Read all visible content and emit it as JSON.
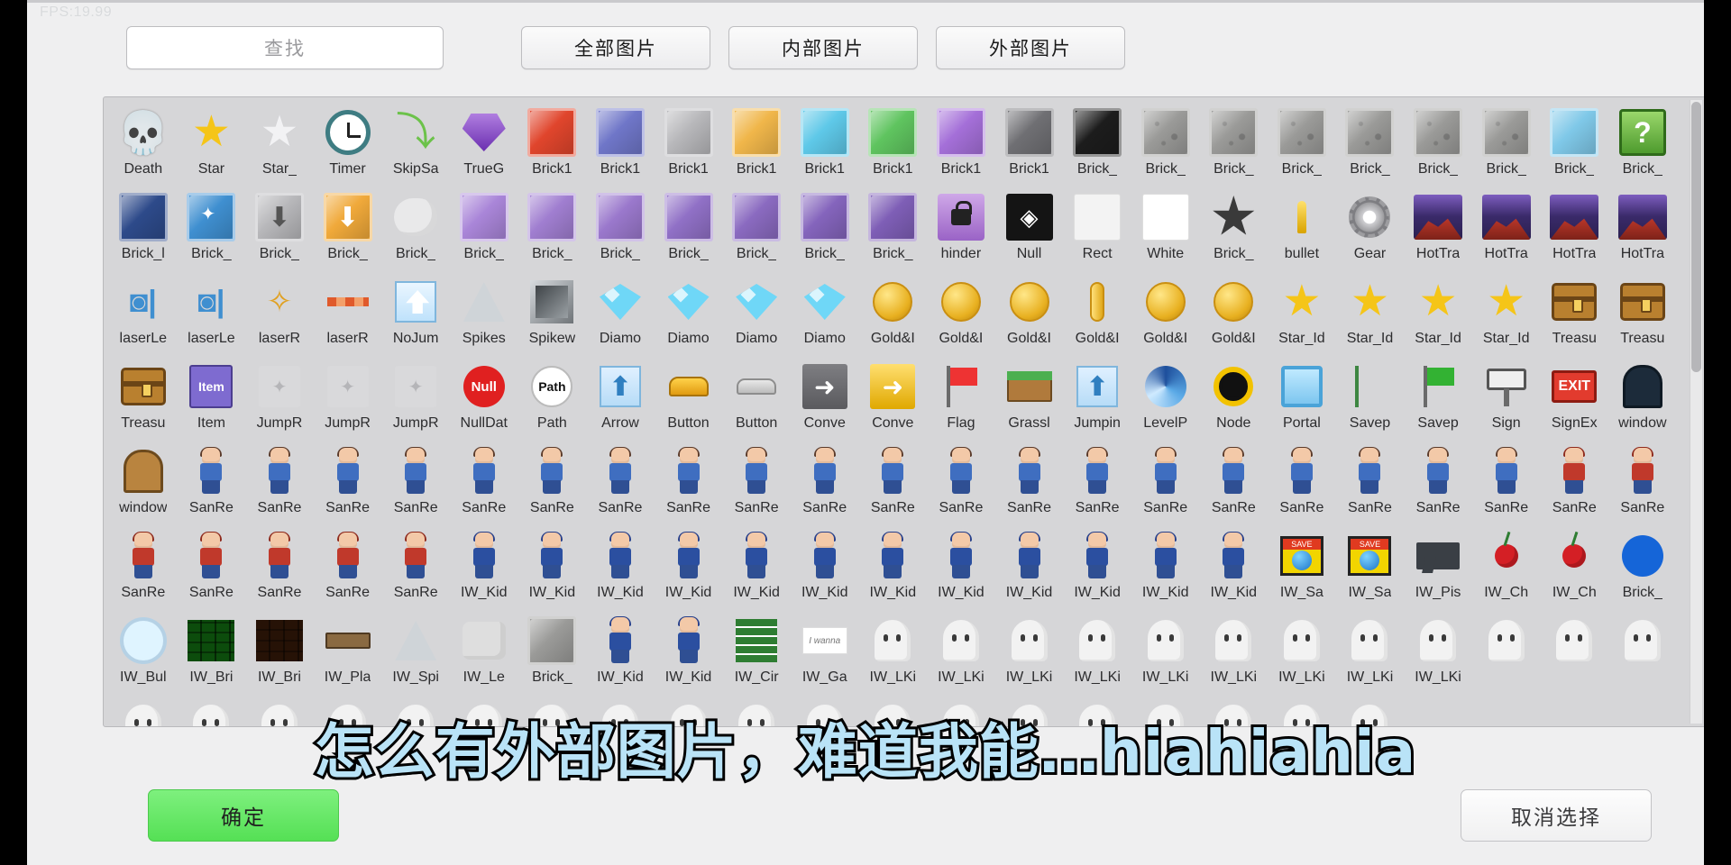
{
  "overlay": {
    "fps": "FPS:19.99",
    "subtitle": "怎么有外部图片，难道我能…hiahiahia"
  },
  "toolbar": {
    "search_placeholder": "查找",
    "search_value": "",
    "tabs": [
      {
        "label": "全部图片",
        "name": "tab-all-images"
      },
      {
        "label": "内部图片",
        "name": "tab-internal-images"
      },
      {
        "label": "外部图片",
        "name": "tab-external-images"
      }
    ]
  },
  "footer": {
    "confirm_label": "确定",
    "cancel_label": "取消选择"
  },
  "grid": {
    "items": [
      {
        "cap": "Death",
        "icon": "skull-icon"
      },
      {
        "cap": "Star",
        "icon": "star-yellow-icon"
      },
      {
        "cap": "Star_",
        "icon": "star-white-icon"
      },
      {
        "cap": "Timer",
        "icon": "clock-icon"
      },
      {
        "cap": "SkipSa",
        "icon": "green-arrow-icon"
      },
      {
        "cap": "TrueG",
        "icon": "purple-gem-icon"
      },
      {
        "cap": "Brick1",
        "icon": "brick-red-icon"
      },
      {
        "cap": "Brick1",
        "icon": "brick-indigo-icon"
      },
      {
        "cap": "Brick1",
        "icon": "brick-gray-icon"
      },
      {
        "cap": "Brick1",
        "icon": "brick-orange-icon"
      },
      {
        "cap": "Brick1",
        "icon": "brick-cyan-icon"
      },
      {
        "cap": "Brick1",
        "icon": "brick-green-icon"
      },
      {
        "cap": "Brick1",
        "icon": "brick-violet-icon"
      },
      {
        "cap": "Brick1",
        "icon": "brick-darkgray-icon"
      },
      {
        "cap": "Brick_",
        "icon": "brick-black-icon"
      },
      {
        "cap": "Brick_",
        "icon": "stone-icon"
      },
      {
        "cap": "Brick_",
        "icon": "stone-cracked-icon"
      },
      {
        "cap": "Brick_",
        "icon": "stone-rubble-icon"
      },
      {
        "cap": "Brick_",
        "icon": "stone-rubble2-icon"
      },
      {
        "cap": "Brick_",
        "icon": "stone-rubble3-icon"
      },
      {
        "cap": "Brick_",
        "icon": "stone-rubble4-icon"
      },
      {
        "cap": "Brick_",
        "icon": "brick-lightblue-icon"
      },
      {
        "cap": "Brick_",
        "icon": "question-block-icon"
      },
      {
        "cap": "Brick_l",
        "icon": "brick-navy-icon"
      },
      {
        "cap": "Brick_",
        "icon": "brick-sparkle-icon"
      },
      {
        "cap": "Brick_",
        "icon": "arrow-down-gray-icon"
      },
      {
        "cap": "Brick_",
        "icon": "arrow-down-orange-icon"
      },
      {
        "cap": "Brick_",
        "icon": "cloud-icon"
      },
      {
        "cap": "Brick_",
        "icon": "brick-purple1-icon"
      },
      {
        "cap": "Brick_",
        "icon": "brick-purple2-icon"
      },
      {
        "cap": "Brick_",
        "icon": "brick-purple3-icon"
      },
      {
        "cap": "Brick_",
        "icon": "brick-purple4-icon"
      },
      {
        "cap": "Brick_",
        "icon": "brick-purple5-icon"
      },
      {
        "cap": "Brick_",
        "icon": "brick-purple6-icon"
      },
      {
        "cap": "Brick_",
        "icon": "brick-purple7-icon"
      },
      {
        "cap": "hinder",
        "icon": "lock-icon"
      },
      {
        "cap": "Null",
        "icon": "unity-logo-icon"
      },
      {
        "cap": "Rect",
        "icon": "rect-icon"
      },
      {
        "cap": "White",
        "icon": "white-square-icon"
      },
      {
        "cap": "Brick_",
        "icon": "burst-icon"
      },
      {
        "cap": "bullet",
        "icon": "bullet-icon"
      },
      {
        "cap": "Gear",
        "icon": "gear-icon"
      },
      {
        "cap": "HotTra",
        "icon": "volcano1-icon"
      },
      {
        "cap": "HotTra",
        "icon": "volcano2-icon"
      },
      {
        "cap": "HotTra",
        "icon": "volcano3-icon"
      },
      {
        "cap": "HotTra",
        "icon": "volcano4-icon"
      },
      {
        "cap": "laserLe",
        "icon": "laser-left-icon"
      },
      {
        "cap": "laserLe",
        "icon": "laser-left2-icon"
      },
      {
        "cap": "laserR",
        "icon": "laser-right-icon"
      },
      {
        "cap": "laserR",
        "icon": "laser-right2-icon"
      },
      {
        "cap": "NoJum",
        "icon": "no-jump-icon"
      },
      {
        "cap": "Spikes",
        "icon": "spikes-icon"
      },
      {
        "cap": "Spikew",
        "icon": "spike-wall-icon"
      },
      {
        "cap": "Diamo",
        "icon": "diamond1-icon"
      },
      {
        "cap": "Diamo",
        "icon": "diamond2-icon"
      },
      {
        "cap": "Diamo",
        "icon": "diamond3-icon"
      },
      {
        "cap": "Diamo",
        "icon": "diamond4-icon"
      },
      {
        "cap": "Gold&I",
        "icon": "gold-coin1-icon"
      },
      {
        "cap": "Gold&I",
        "icon": "gold-coin2-icon"
      },
      {
        "cap": "Gold&I",
        "icon": "gold-coin3-icon"
      },
      {
        "cap": "Gold&I",
        "icon": "gold-bar-icon"
      },
      {
        "cap": "Gold&I",
        "icon": "gold-coin4-icon"
      },
      {
        "cap": "Gold&I",
        "icon": "gold-coin5-icon"
      },
      {
        "cap": "Star_Id",
        "icon": "star-id1-icon"
      },
      {
        "cap": "Star_Id",
        "icon": "star-id2-icon"
      },
      {
        "cap": "Star_Id",
        "icon": "star-id3-icon"
      },
      {
        "cap": "Star_Id",
        "icon": "star-id4-icon"
      },
      {
        "cap": "Treasu",
        "icon": "treasure-chest1-icon"
      },
      {
        "cap": "Treasu",
        "icon": "treasure-chest2-icon"
      },
      {
        "cap": "Treasu",
        "icon": "treasure-chest3-icon"
      },
      {
        "cap": "Item",
        "icon": "item-box-icon"
      },
      {
        "cap": "JumpR",
        "icon": "jump-refresher1-icon"
      },
      {
        "cap": "JumpR",
        "icon": "jump-refresher2-icon"
      },
      {
        "cap": "JumpR",
        "icon": "jump-refresher3-icon"
      },
      {
        "cap": "NullDat",
        "icon": "null-data-icon"
      },
      {
        "cap": "Path",
        "icon": "path-icon"
      },
      {
        "cap": "Arrow",
        "icon": "arrow-up-icon"
      },
      {
        "cap": "Button",
        "icon": "button-yellow-icon"
      },
      {
        "cap": "Button",
        "icon": "button-gray-icon"
      },
      {
        "cap": "Conve",
        "icon": "conveyor-right-icon"
      },
      {
        "cap": "Conve",
        "icon": "conveyor-yellow-icon"
      },
      {
        "cap": "Flag",
        "icon": "flag-red-icon"
      },
      {
        "cap": "Grassl",
        "icon": "grassland-icon"
      },
      {
        "cap": "Jumpin",
        "icon": "jumping-icon"
      },
      {
        "cap": "LevelP",
        "icon": "level-portal-icon"
      },
      {
        "cap": "Node",
        "icon": "node-icon"
      },
      {
        "cap": "Portal",
        "icon": "portal-icon"
      },
      {
        "cap": "Savep",
        "icon": "savepoint-icon"
      },
      {
        "cap": "Savep",
        "icon": "savepoint-flag-icon"
      },
      {
        "cap": "Sign",
        "icon": "sign-icon"
      },
      {
        "cap": "SignEx",
        "icon": "sign-exit-icon"
      },
      {
        "cap": "window",
        "icon": "window-dark-icon"
      },
      {
        "cap": "window",
        "icon": "window-wood-icon"
      },
      {
        "cap": "SanRe",
        "icon": "sanre-char1-icon"
      },
      {
        "cap": "SanRe",
        "icon": "sanre-char2-icon"
      },
      {
        "cap": "SanRe",
        "icon": "sanre-char3-icon"
      },
      {
        "cap": "SanRe",
        "icon": "sanre-char4-icon"
      },
      {
        "cap": "SanRe",
        "icon": "sanre-char5-icon"
      },
      {
        "cap": "SanRe",
        "icon": "sanre-char6-icon"
      },
      {
        "cap": "SanRe",
        "icon": "sanre-char7-icon"
      },
      {
        "cap": "SanRe",
        "icon": "sanre-char8-icon"
      },
      {
        "cap": "SanRe",
        "icon": "sanre-char9-icon"
      },
      {
        "cap": "SanRe",
        "icon": "sanre-char10-icon"
      },
      {
        "cap": "SanRe",
        "icon": "sanre-char11-icon"
      },
      {
        "cap": "SanRe",
        "icon": "sanre-char12-icon"
      },
      {
        "cap": "SanRe",
        "icon": "sanre-char13-icon"
      },
      {
        "cap": "SanRe",
        "icon": "sanre-char14-icon"
      },
      {
        "cap": "SanRe",
        "icon": "sanre-char15-icon"
      },
      {
        "cap": "SanRe",
        "icon": "sanre-char16-icon"
      },
      {
        "cap": "SanRe",
        "icon": "sanre-char17-icon"
      },
      {
        "cap": "SanRe",
        "icon": "sanre-char18-icon"
      },
      {
        "cap": "SanRe",
        "icon": "sanre-char19-icon"
      },
      {
        "cap": "SanRe",
        "icon": "sanre-char20-icon"
      },
      {
        "cap": "SanRe",
        "icon": "sanre-red1-icon"
      },
      {
        "cap": "SanRe",
        "icon": "sanre-red2-icon"
      },
      {
        "cap": "SanRe",
        "icon": "sanre-red3-icon"
      },
      {
        "cap": "SanRe",
        "icon": "sanre-red4-icon"
      },
      {
        "cap": "SanRe",
        "icon": "sanre-red5-icon"
      },
      {
        "cap": "SanRe",
        "icon": "sanre-red6-icon"
      },
      {
        "cap": "SanRe",
        "icon": "sanre-red7-icon"
      },
      {
        "cap": "IW_Kid",
        "icon": "iw-kid1-icon"
      },
      {
        "cap": "IW_Kid",
        "icon": "iw-kid2-icon"
      },
      {
        "cap": "IW_Kid",
        "icon": "iw-kid3-icon"
      },
      {
        "cap": "IW_Kid",
        "icon": "iw-kid4-icon"
      },
      {
        "cap": "IW_Kid",
        "icon": "iw-kid5-icon"
      },
      {
        "cap": "IW_Kid",
        "icon": "iw-kid6-icon"
      },
      {
        "cap": "IW_Kid",
        "icon": "iw-kid7-icon"
      },
      {
        "cap": "IW_Kid",
        "icon": "iw-kid8-icon"
      },
      {
        "cap": "IW_Kid",
        "icon": "iw-kid9-icon"
      },
      {
        "cap": "IW_Kid",
        "icon": "iw-kid10-icon"
      },
      {
        "cap": "IW_Kid",
        "icon": "iw-kid11-icon"
      },
      {
        "cap": "IW_Kid",
        "icon": "iw-kid12-icon"
      },
      {
        "cap": "IW_Sa",
        "icon": "iw-save1-icon"
      },
      {
        "cap": "IW_Sa",
        "icon": "iw-save2-icon"
      },
      {
        "cap": "IW_Pis",
        "icon": "iw-pistol-icon"
      },
      {
        "cap": "IW_Ch",
        "icon": "cherry1-icon"
      },
      {
        "cap": "IW_Ch",
        "icon": "cherry2-icon"
      },
      {
        "cap": "Brick_",
        "icon": "blue-circle-icon"
      },
      {
        "cap": "IW_Bul",
        "icon": "iw-bullet-icon"
      },
      {
        "cap": "IW_Bri",
        "icon": "iw-brick1-icon"
      },
      {
        "cap": "IW_Bri",
        "icon": "iw-brick2-icon"
      },
      {
        "cap": "IW_Pla",
        "icon": "iw-platform-icon"
      },
      {
        "cap": "IW_Spi",
        "icon": "iw-spike-icon"
      },
      {
        "cap": "IW_Le",
        "icon": "iw-ledge-icon"
      },
      {
        "cap": "Brick_",
        "icon": "brick-plate-icon"
      },
      {
        "cap": "IW_Kid",
        "icon": "iw-kid13-icon"
      },
      {
        "cap": "IW_Kid",
        "icon": "iw-kid14-icon"
      },
      {
        "cap": "IW_Cir",
        "icon": "iw-circuit-icon"
      },
      {
        "cap": "IW_Ga",
        "icon": "iw-game-icon"
      },
      {
        "cap": "IW_LKi",
        "icon": "iw-lkid1-icon"
      },
      {
        "cap": "IW_LKi",
        "icon": "iw-lkid2-icon"
      },
      {
        "cap": "IW_LKi",
        "icon": "iw-lkid3-icon"
      },
      {
        "cap": "IW_LKi",
        "icon": "iw-lkid4-icon"
      },
      {
        "cap": "IW_LKi",
        "icon": "iw-lkid5-icon"
      },
      {
        "cap": "IW_LKi",
        "icon": "iw-lkid6-icon"
      },
      {
        "cap": "IW_LKi",
        "icon": "iw-lkid7-icon"
      },
      {
        "cap": "IW_LKi",
        "icon": "iw-lkid8-icon"
      },
      {
        "cap": "IW_LKi",
        "icon": "iw-lkid9-icon"
      },
      {
        "cap": "",
        "icon": "iw-lkid10-icon"
      },
      {
        "cap": "",
        "icon": "partial-row-icon1"
      },
      {
        "cap": "",
        "icon": "partial-row-icon2"
      },
      {
        "cap": "",
        "icon": "partial-row-icon3"
      },
      {
        "cap": "",
        "icon": "partial-row-icon4"
      },
      {
        "cap": "",
        "icon": "partial-row-icon5"
      },
      {
        "cap": "",
        "icon": "partial-row-icon6"
      },
      {
        "cap": "",
        "icon": "partial-row-icon7"
      },
      {
        "cap": "",
        "icon": "partial-row-icon8"
      },
      {
        "cap": "",
        "icon": "partial-row-icon9"
      },
      {
        "cap": "",
        "icon": "partial-row-icon10"
      },
      {
        "cap": "",
        "icon": "partial-row-icon11"
      },
      {
        "cap": "",
        "icon": "partial-row-icon12"
      },
      {
        "cap": "",
        "icon": "partial-row-icon13"
      },
      {
        "cap": "",
        "icon": "partial-row-icon14"
      },
      {
        "cap": "",
        "icon": "partial-row-icon15"
      },
      {
        "cap": "",
        "icon": "partial-row-icon16"
      },
      {
        "cap": "",
        "icon": "partial-row-icon17"
      },
      {
        "cap": "",
        "icon": "partial-row-icon18"
      },
      {
        "cap": "",
        "icon": "partial-row-icon19"
      },
      {
        "cap": "",
        "icon": "partial-row-icon20"
      },
      {
        "cap": "",
        "icon": "partial-row-icon21"
      }
    ]
  }
}
